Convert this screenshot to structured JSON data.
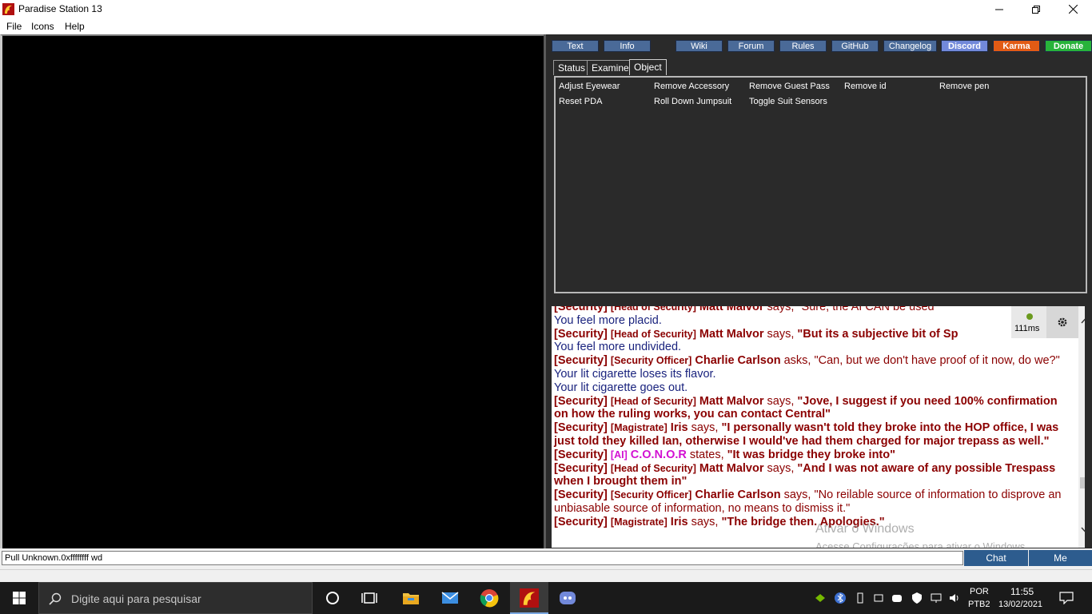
{
  "window": {
    "title": "Paradise Station 13",
    "minimize": "—",
    "restore": "❐",
    "close": "✕"
  },
  "menu": [
    "File",
    "Icons",
    "Help"
  ],
  "top_buttons": [
    "Text",
    "Info",
    "Wiki",
    "Forum",
    "Rules",
    "GitHub",
    "Changelog",
    "Discord",
    "Karma",
    "Donate"
  ],
  "tabs": [
    "Status",
    "Examine",
    "Object"
  ],
  "verbs": [
    [
      "Adjust Eyewear",
      "Remove Accessory",
      "Remove Guest Pass",
      "Remove id",
      "Remove pen"
    ],
    [
      "Reset PDA",
      "Roll Down Jumpsuit",
      "Toggle Suit Sensors"
    ]
  ],
  "chat": {
    "ping": "111ms",
    "lines": [
      {
        "type": "radio",
        "tag": "[Security]",
        "role": "[Head of Security]",
        "name": "Matt Malvor",
        "verb": "says,",
        "quote": "\"Sure, the AI CAN be used",
        "bold_quote": false
      },
      {
        "type": "plain",
        "text": "You feel more placid."
      },
      {
        "type": "radio",
        "tag": "[Security]",
        "role": "[Head of Security]",
        "name": "Matt Malvor",
        "verb": "says,",
        "quote": "\"But its a subjective bit of Sp",
        "bold_quote": true
      },
      {
        "type": "plain",
        "text": "You feel more undivided."
      },
      {
        "type": "radio",
        "tag": "[Security]",
        "role": "[Security Officer]",
        "name": "Charlie Carlson",
        "verb": "asks,",
        "quote": "\"Can, but we don't have proof of it now, do we?\"",
        "bold_quote": false
      },
      {
        "type": "plain",
        "text": "Your lit cigarette loses its flavor."
      },
      {
        "type": "plain",
        "text": "Your lit cigarette goes out."
      },
      {
        "type": "radio",
        "tag": "[Security]",
        "role": "[Head of Security]",
        "name": "Matt Malvor",
        "verb": "says,",
        "quote": "\"Jove, I suggest if you need 100% confirmation on how the ruling works, you can contact Central\"",
        "bold_quote": true
      },
      {
        "type": "radio",
        "tag": "[Security]",
        "role": "[Magistrate]",
        "name": "Iris",
        "verb": "says,",
        "quote": "\"I personally wasn't told they broke into the HOP office, I was just told they killed Ian, otherwise I would've had them charged for major trepass as well.\"",
        "bold_quote": true
      },
      {
        "type": "ai",
        "tag": "[Security]",
        "role": "[AI]",
        "name": "C.O.N.O.R",
        "verb": "states,",
        "quote": "\"It was bridge they broke into\"",
        "bold_quote": true
      },
      {
        "type": "radio",
        "tag": "[Security]",
        "role": "[Head of Security]",
        "name": "Matt Malvor",
        "verb": "says,",
        "quote": "\"And I was not aware of any possible Trespass when I brought them in\"",
        "bold_quote": true
      },
      {
        "type": "radio",
        "tag": "[Security]",
        "role": "[Security Officer]",
        "name": "Charlie Carlson",
        "verb": "says,",
        "quote": "\"No reilable source of information to disprove an unbiasable source of information, no means to dismiss it.\"",
        "bold_quote": false
      },
      {
        "type": "radio",
        "tag": "[Security]",
        "role": "[Magistrate]",
        "name": "Iris",
        "verb": "says,",
        "quote": "\"The bridge then. Apologies.\"",
        "bold_quote": true
      }
    ],
    "watermark1": "Ativar o Windows",
    "watermark2": "Acesse Configurações para ativar o Windows."
  },
  "status_text": "Pull Unknown.0xffffffff wd",
  "chat_buttons": [
    "Chat",
    "Me"
  ],
  "taskbar": {
    "search_placeholder": "Digite aqui para pesquisar",
    "lang1": "POR",
    "lang2": "PTB2",
    "time": "11:55",
    "date": "13/02/2021"
  }
}
